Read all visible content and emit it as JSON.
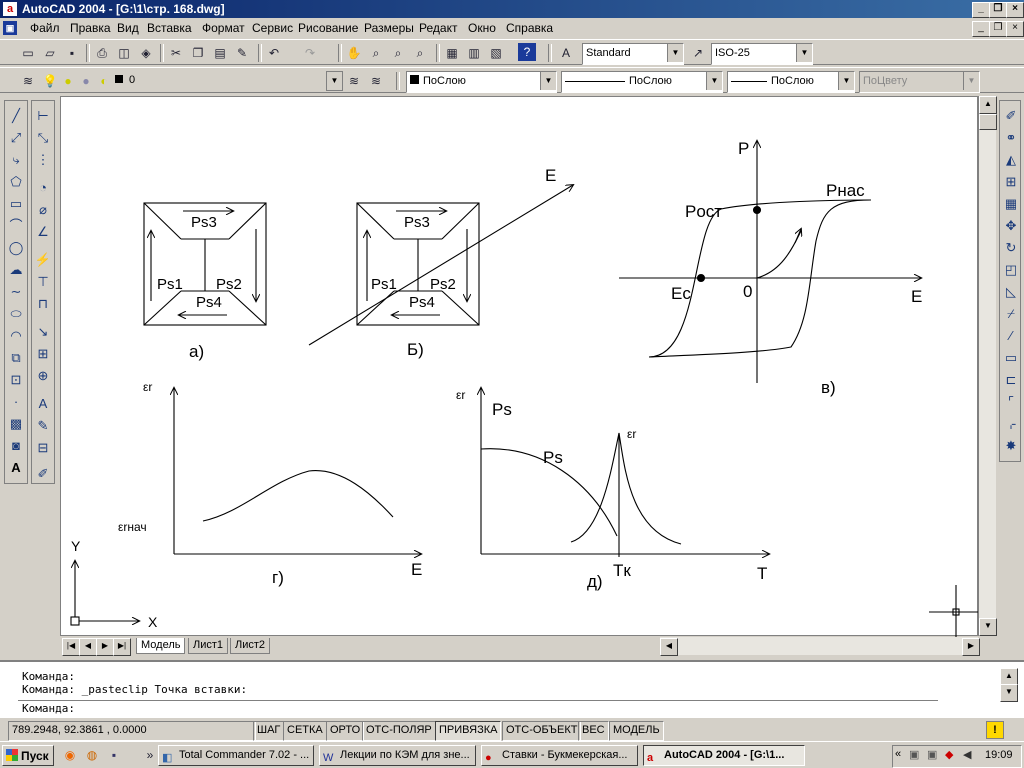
{
  "window": {
    "title": "AutoCAD 2004 - [G:\\1\\стр. 168.dwg]"
  },
  "menu": [
    "Файл",
    "Правка",
    "Вид",
    "Вставка",
    "Формат",
    "Сервис",
    "Рисование",
    "Размеры",
    "Редакт",
    "Окно",
    "Справка"
  ],
  "toolbar": {
    "text_style": "Standard",
    "dim_style": "ISO-25",
    "layer": "0",
    "color": "ПоСлою",
    "linetype": "ПоСлою",
    "lineweight": "ПоСлою",
    "plotstyle": "ПоЦвету"
  },
  "drawing": {
    "a": {
      "ps3": "Ps3",
      "ps1": "Ps1",
      "ps2": "Ps2",
      "ps4": "Ps4",
      "caption": "а)"
    },
    "b": {
      "ps3": "Ps3",
      "ps1": "Ps1",
      "ps2": "Ps2",
      "ps4": "Ps4",
      "caption": "Б)",
      "field": "E"
    },
    "v": {
      "p": "P",
      "e": "E",
      "post": "Pост",
      "pnas": "Pнас",
      "ec": "Ec",
      "zero": "0",
      "caption": "в)"
    },
    "g": {
      "er": "εr",
      "ernach": "εrнач",
      "e": "E",
      "caption": "г)"
    },
    "d": {
      "er": "εr",
      "ps_axis": "Ps",
      "ps_curve": "Ps",
      "er_peak": "εr",
      "tk": "Tк",
      "t": "T",
      "caption": "д)"
    },
    "ucs": {
      "x": "X",
      "y": "Y"
    }
  },
  "tabs": [
    "Модель",
    "Лист1",
    "Лист2"
  ],
  "command": {
    "line1": "Команда:",
    "line2": "Команда: _pasteclip Точка вставки:",
    "prompt": "Команда:"
  },
  "status": {
    "coords": "789.2948, 92.3861 , 0.0000",
    "buttons": [
      "ШАГ",
      "СЕТКА",
      "ОРТО",
      "ОТС-ПОЛЯР",
      "ПРИВЯЗКА",
      "ОТС-ОБЪЕКТ",
      "ВЕС",
      "МОДЕЛЬ"
    ]
  },
  "taskbar": {
    "start": "Пуск",
    "tasks": [
      "Total Commander 7.02 - ...",
      "Лекции по КЭМ для зне...",
      "Ставки - Букмекерская...",
      "AutoCAD 2004 - [G:\\1..."
    ],
    "clock": "19:09"
  }
}
